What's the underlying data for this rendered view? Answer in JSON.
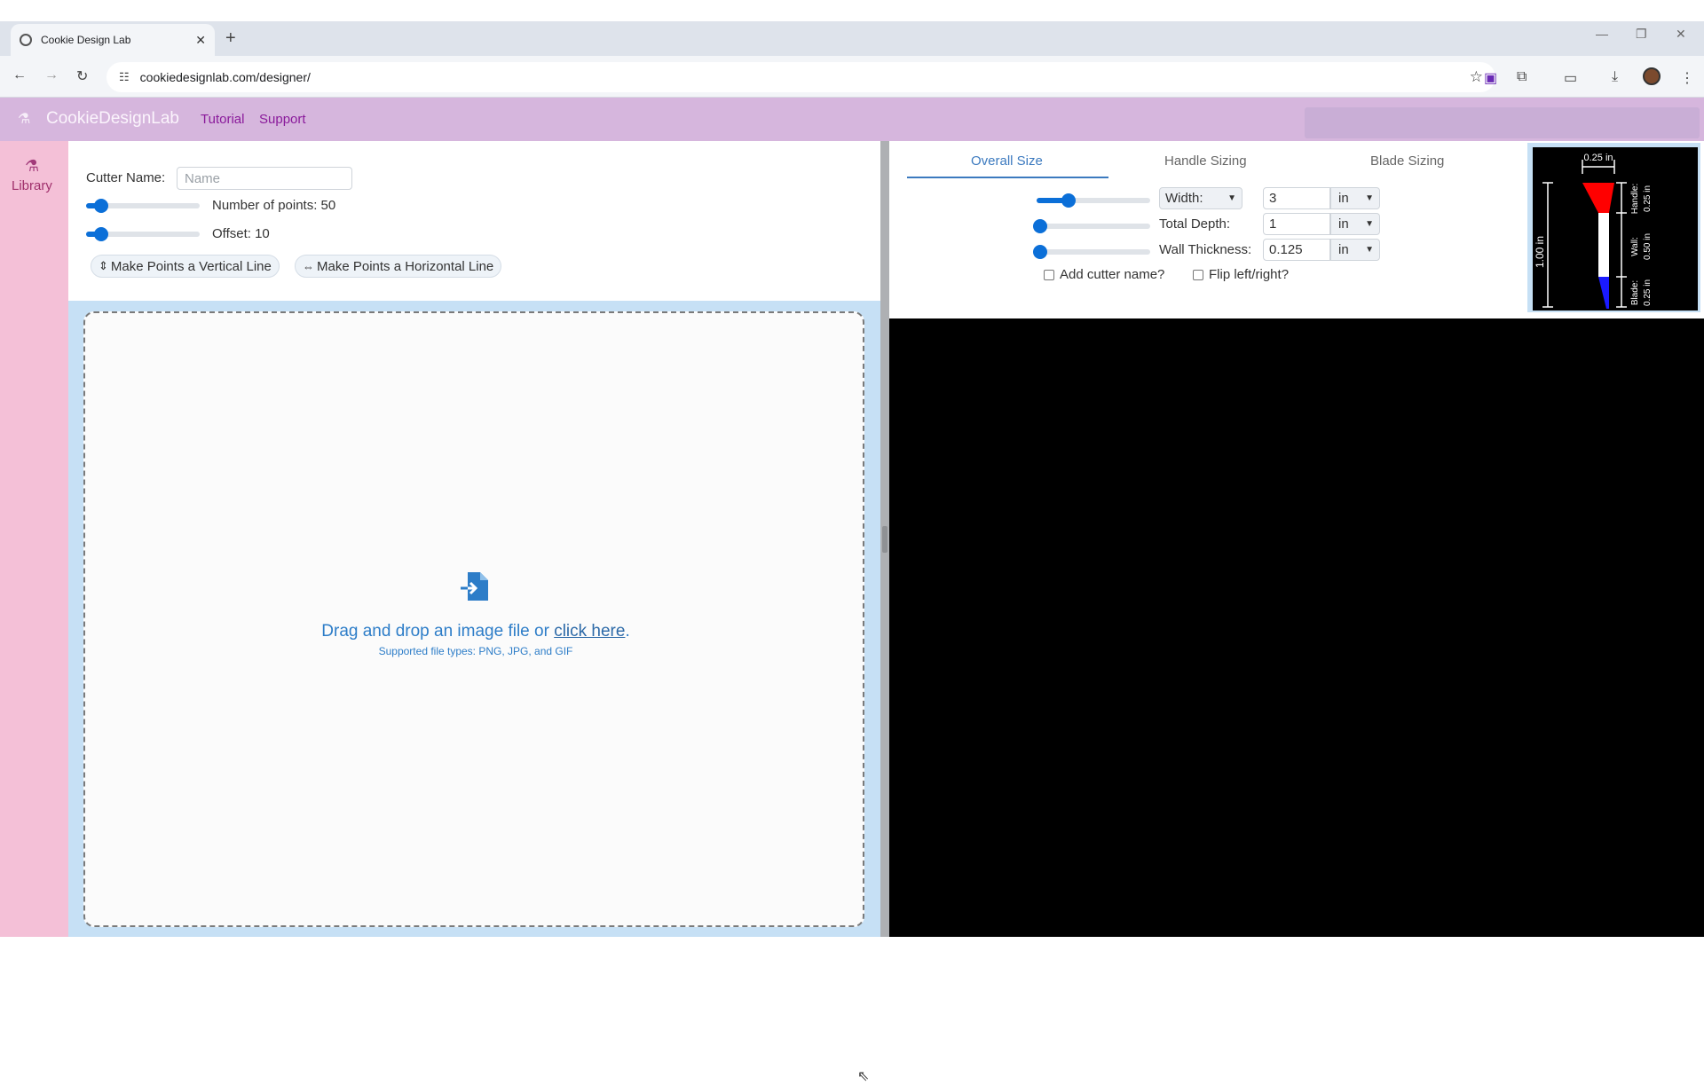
{
  "browser": {
    "tab_title": "Cookie Design Lab",
    "url": "cookiedesignlab.com/designer/"
  },
  "header": {
    "brand": "CookieDesignLab",
    "nav": [
      "Tutorial",
      "Support"
    ]
  },
  "sidebar": {
    "items": [
      {
        "label": "Library",
        "icon": "library-icon"
      }
    ]
  },
  "left": {
    "cutter_name_label": "Cutter Name:",
    "cutter_name_value": "",
    "cutter_name_placeholder": "Name",
    "points_label": "Number of points: 50",
    "points_slider_fraction": 0.1,
    "offset_label": "Offset: 10",
    "offset_slider_fraction": 0.1,
    "vertical_btn": "Make Points a Vertical Line",
    "horizontal_btn": "Make Points a Horizontal Line"
  },
  "dropzone": {
    "text_before": "Drag and drop an image file or ",
    "link": "click here",
    "text_after": ".",
    "supported": "Supported file types: PNG, JPG, and GIF"
  },
  "right": {
    "tabs": [
      "Overall Size",
      "Handle Sizing",
      "Blade Sizing"
    ],
    "active_tab": "Overall Size",
    "rows": [
      {
        "label": "Width:",
        "label_is_select": true,
        "value": "3",
        "unit": "in",
        "slider_fraction": 0.25
      },
      {
        "label": "Total Depth:",
        "label_is_select": false,
        "value": "1",
        "unit": "in",
        "slider_fraction": 0.0
      },
      {
        "label": "Wall Thickness:",
        "label_is_select": false,
        "value": "0.125",
        "unit": "in",
        "slider_fraction": 0.0
      }
    ],
    "add_cutter_name": "Add cutter name?",
    "flip": "Flip left/right?"
  },
  "preview": {
    "top_dim": "0.25 in",
    "height_dim": "1.00 in",
    "handle_label": "Handle:",
    "handle_value": "0.25 in",
    "wall_label": "Wall:",
    "wall_value": "0.50 in",
    "blade_label": "Blade:",
    "blade_value": "0.25 in",
    "colors": {
      "handle": "#ff0000",
      "wall": "#ffffff",
      "blade": "#1a1aff"
    }
  },
  "colors": {
    "header_bg": "#d6b6dd",
    "sidebar_bg": "#f4c0d7",
    "accent": "#0b6fd8",
    "link": "#2d7dc8"
  }
}
